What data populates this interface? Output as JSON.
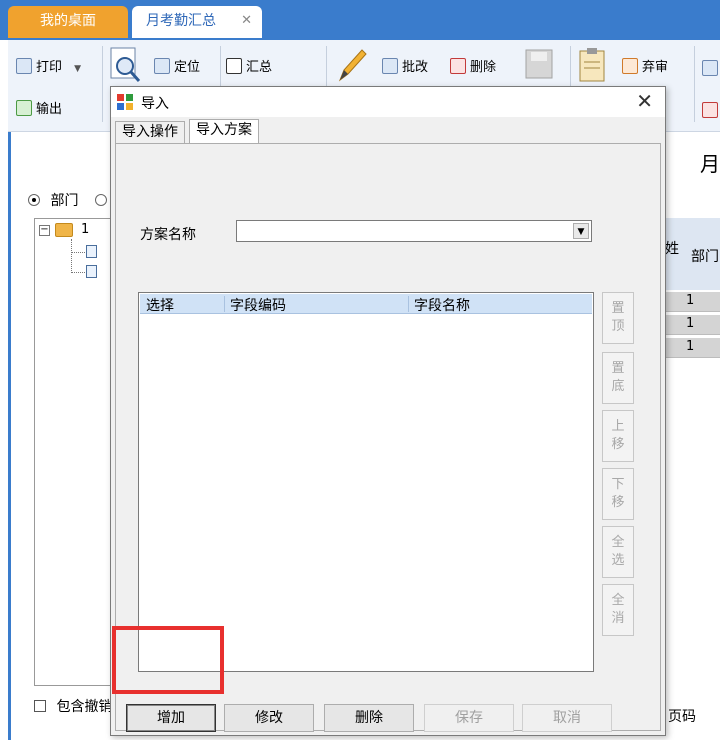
{
  "tabs": {
    "home": "我的桌面",
    "active": "月考勤汇总",
    "close": "✕"
  },
  "toolbar": {
    "print": "打印",
    "export": "输出",
    "locate": "定位",
    "summary": "汇总",
    "edit": "批改",
    "delete": "删除",
    "abandon": "弃审"
  },
  "background": {
    "title_partial": "月",
    "radio_dept": "部门",
    "tree_root": "1",
    "include_cancel": "包含撤销",
    "grid_col_name": "姓",
    "grid_col_dept": "部门",
    "grid_rows": [
      "1",
      "1",
      "1"
    ],
    "page_label": "页码"
  },
  "dialog": {
    "title": "导入",
    "close": "✕",
    "tab_operate": "导入操作",
    "tab_plan": "导入方案",
    "plan_label": "方案名称",
    "plan_value": "",
    "columns": [
      "选择",
      "字段编码",
      "字段名称"
    ],
    "side_buttons": [
      [
        "置",
        "顶"
      ],
      [
        "置",
        "底"
      ],
      [
        "上",
        "移"
      ],
      [
        "下",
        "移"
      ],
      [
        "全",
        "选"
      ],
      [
        "全",
        "消"
      ]
    ],
    "buttons": {
      "add": "增加",
      "modify": "修改",
      "delete": "删除",
      "save": "保存",
      "cancel": "取消"
    }
  },
  "colors": {
    "tab_bar": "#3a7ccc",
    "home_tab": "#f0a22e",
    "highlight": "#e8302e"
  }
}
